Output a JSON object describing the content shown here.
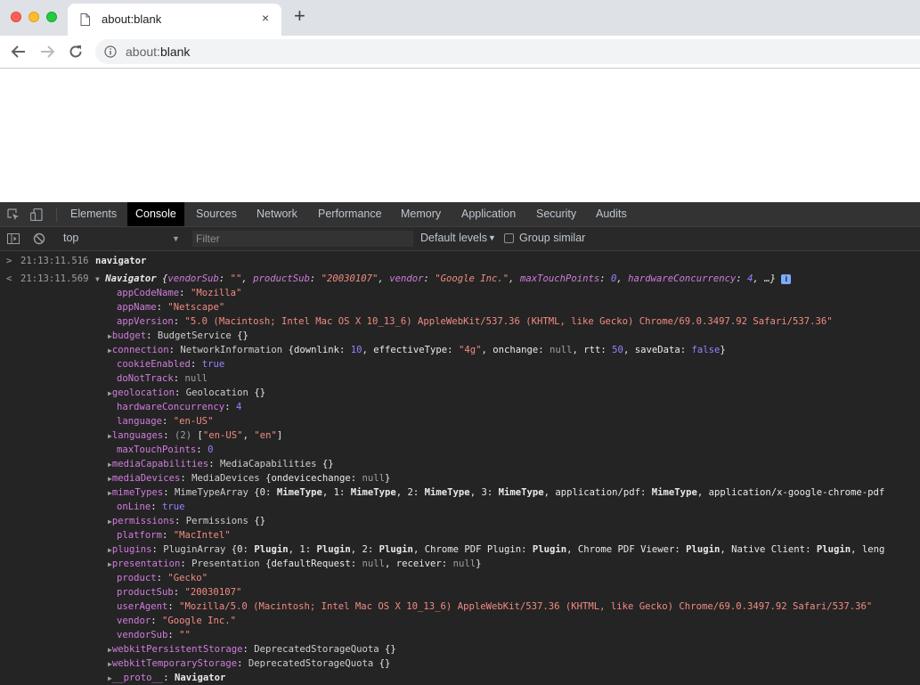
{
  "browser": {
    "tab_title": "about:blank",
    "tab_close": "×",
    "new_tab": "+",
    "url_prefix": "about:",
    "url_main": "blank"
  },
  "devtools": {
    "tabs": [
      "Elements",
      "Console",
      "Sources",
      "Network",
      "Performance",
      "Memory",
      "Application",
      "Security",
      "Audits"
    ],
    "active_tab": "Console",
    "context": "top",
    "filter_placeholder": "Filter",
    "levels": "Default levels",
    "group_similar": "Group similar"
  },
  "console": {
    "input": {
      "time": "21:13:11.516",
      "expr": "navigator"
    },
    "output_time": "21:13:11.569",
    "summary": {
      "type": "Navigator",
      "vendorSub": "\"\"",
      "productSub": "\"20030107\"",
      "vendor": "\"Google Inc.\"",
      "maxTouchPoints": "0",
      "hardwareConcurrency": "4",
      "more": "…}"
    },
    "props": {
      "appCodeName": "\"Mozilla\"",
      "appName": "\"Netscape\"",
      "appVersion": "\"5.0 (Macintosh; Intel Mac OS X 10_13_6) AppleWebKit/537.36 (KHTML, like Gecko) Chrome/69.0.3497.92 Safari/537.36\"",
      "budget": "BudgetService",
      "connection_type": "NetworkInformation",
      "downlink": "10",
      "effectiveType": "\"4g\"",
      "onchange": "null",
      "rtt": "50",
      "saveData": "false",
      "cookieEnabled": "true",
      "doNotTrack": "null",
      "geolocation": "Geolocation",
      "hardwareConcurrency": "4",
      "language": "\"en-US\"",
      "languages_count": "(2)",
      "languages_0": "\"en-US\"",
      "languages_1": "\"en\"",
      "maxTouchPoints": "0",
      "mediaCapabilities": "MediaCapabilities",
      "mediaDevices": "MediaDevices",
      "ondevicechange": "null",
      "mimeTypes": "MimeTypeArray",
      "mimeTypes_tail": "application/x-google-chrome-pdf",
      "onLine": "true",
      "permissions": "Permissions",
      "platform": "\"MacIntel\"",
      "plugins": "PluginArray",
      "plugins_tail": "Native Client",
      "plugins_tail2": "leng",
      "presentation": "Presentation",
      "defaultRequest": "null",
      "receiver": "null",
      "product": "\"Gecko\"",
      "productSub": "\"20030107\"",
      "userAgent": "\"Mozilla/5.0 (Macintosh; Intel Mac OS X 10_13_6) AppleWebKit/537.36 (KHTML, like Gecko) Chrome/69.0.3497.92 Safari/537.36\"",
      "vendor": "\"Google Inc.\"",
      "vendorSub": "\"\"",
      "webkitPersistentStorage": "DeprecatedStorageQuota",
      "webkitTemporaryStorage": "DeprecatedStorageQuota",
      "proto": "Navigator"
    }
  }
}
